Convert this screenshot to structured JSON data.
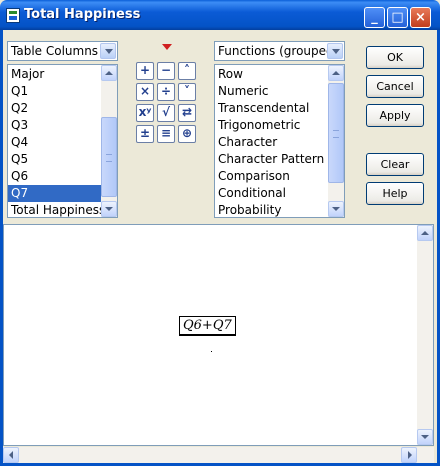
{
  "window": {
    "title": "Total Happiness",
    "minimize_glyph": "_",
    "maximize_glyph": "□",
    "close_glyph": "×"
  },
  "columns_selector": {
    "value": "Table Columns",
    "items": [
      "Major",
      "Q1",
      "Q2",
      "Q3",
      "Q4",
      "Q5",
      "Q6",
      "Q7",
      "Total Happiness"
    ],
    "selected": "Q7"
  },
  "functions_selector": {
    "value": "Functions (grouped)",
    "items": [
      "Row",
      "Numeric",
      "Transcendental",
      "Trigonometric",
      "Character",
      "Character Pattern",
      "Comparison",
      "Conditional",
      "Probability"
    ]
  },
  "keypad": {
    "buttons": [
      {
        "name": "add-icon",
        "glyph": "+"
      },
      {
        "name": "subtract-icon",
        "glyph": "−"
      },
      {
        "name": "raise-icon",
        "glyph": "˄"
      },
      {
        "name": "multiply-icon",
        "glyph": "×"
      },
      {
        "name": "divide-icon",
        "glyph": "÷"
      },
      {
        "name": "lower-icon",
        "glyph": "˅"
      },
      {
        "name": "power-icon",
        "glyph": "xʸ"
      },
      {
        "name": "root-icon",
        "glyph": "√"
      },
      {
        "name": "swap-icon",
        "glyph": "⇄"
      },
      {
        "name": "negate-icon",
        "glyph": "±"
      },
      {
        "name": "assign-icon",
        "glyph": "≡"
      },
      {
        "name": "local-variable-icon",
        "glyph": "⊕"
      }
    ]
  },
  "buttons": {
    "ok": "OK",
    "cancel": "Cancel",
    "apply": "Apply",
    "clear": "Clear",
    "help": "Help"
  },
  "formula": {
    "expression": "Q6+Q7"
  },
  "colors": {
    "title_bar": "#0453c6",
    "selection": "#316ac5",
    "dialog_bg": "#ece9d8"
  }
}
